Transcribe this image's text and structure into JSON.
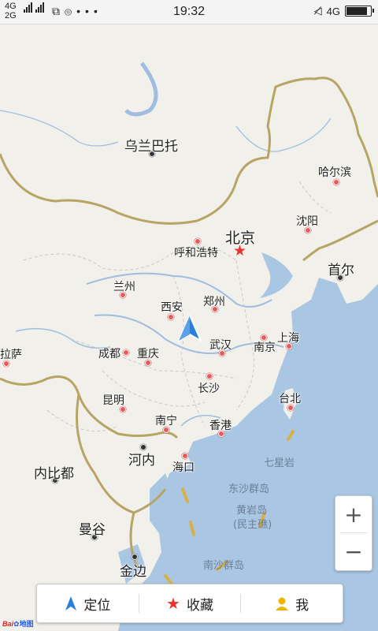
{
  "status_bar": {
    "network_top": "4G",
    "network_bottom": "2G",
    "time": "19:32",
    "right_network": "4G",
    "battery_fraction": 0.9,
    "icons": [
      "sim-icon",
      "hotspot-icon",
      "more-icon",
      "mute-icon",
      "signal-icon"
    ]
  },
  "map": {
    "cities": [
      {
        "id": "ulaanbaatar",
        "name": "乌兰巴托",
        "style": "dark"
      },
      {
        "id": "harbin",
        "name": "哈尔滨",
        "style": "red"
      },
      {
        "id": "shenyang",
        "name": "沈阳",
        "style": "red"
      },
      {
        "id": "beijing",
        "name": "北京",
        "style": "capital"
      },
      {
        "id": "hohhot",
        "name": "呼和浩特",
        "style": "red"
      },
      {
        "id": "seoul",
        "name": "首尔",
        "style": "dark"
      },
      {
        "id": "lanzhou",
        "name": "兰州",
        "style": "red"
      },
      {
        "id": "xian",
        "name": "西安",
        "style": "red"
      },
      {
        "id": "zhengzhou",
        "name": "郑州",
        "style": "red"
      },
      {
        "id": "lhasa",
        "name": "拉萨",
        "style": "red"
      },
      {
        "id": "chengdu",
        "name": "成都",
        "style": "red"
      },
      {
        "id": "chongqing",
        "name": "重庆",
        "style": "red"
      },
      {
        "id": "wuhan",
        "name": "武汉",
        "style": "red"
      },
      {
        "id": "nanjing",
        "name": "南京",
        "style": "red"
      },
      {
        "id": "shanghai",
        "name": "上海",
        "style": "red"
      },
      {
        "id": "changsha",
        "name": "长沙",
        "style": "red"
      },
      {
        "id": "kunming",
        "name": "昆明",
        "style": "red"
      },
      {
        "id": "taipei",
        "name": "台北",
        "style": "red"
      },
      {
        "id": "nanning",
        "name": "南宁",
        "style": "red"
      },
      {
        "id": "hongkong",
        "name": "香港",
        "style": "red"
      },
      {
        "id": "naypyidaw",
        "name": "内比都",
        "style": "dark"
      },
      {
        "id": "hanoi",
        "name": "河内",
        "style": "dark"
      },
      {
        "id": "haikou",
        "name": "海口",
        "style": "red"
      },
      {
        "id": "bangkok",
        "name": "曼谷",
        "style": "dark"
      },
      {
        "id": "phnompenh",
        "name": "金边",
        "style": "dark"
      }
    ],
    "sea_labels": {
      "qixingyan": "七星岩",
      "dongsha": "东沙群岛",
      "huangyan": "黄岩岛",
      "minzhujiao": "(民主礁)",
      "nansha": "南沙群岛"
    },
    "colors": {
      "land": "#f2f0ea",
      "sea": "#a9c6e3",
      "border": "#b8a464",
      "river": "#9fbde0",
      "dashed_border": "#c9c9c9",
      "city_dot": "#e85a5a",
      "capital_star": "#e8342c",
      "location_arrow": "#2b7fd8"
    }
  },
  "controls": {
    "zoom_in": "+",
    "zoom_out": "−",
    "locate_label": "定位",
    "favorites_label": "收藏",
    "me_label": "我"
  },
  "watermark": {
    "brand_a": "Bai",
    "brand_b": "du",
    "suffix": "地图"
  }
}
